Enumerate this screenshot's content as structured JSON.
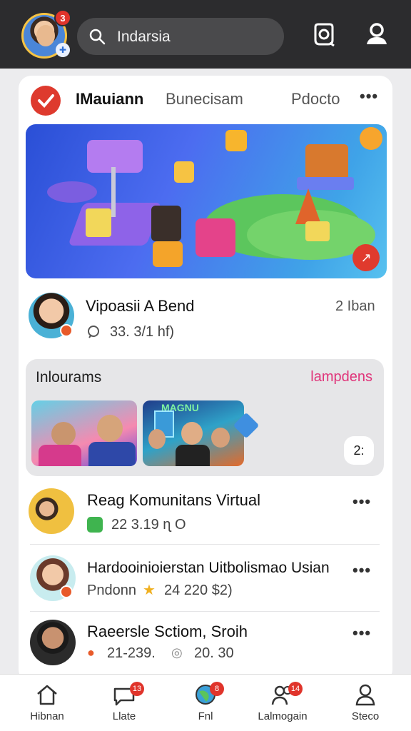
{
  "header": {
    "avatar_badge": "3",
    "search_value": "Indarsia"
  },
  "tabs": [
    {
      "label": "IMauiann"
    },
    {
      "label": "Bunecisam"
    },
    {
      "label": "Pdocto"
    }
  ],
  "feed": {
    "item1": {
      "name": "Vipoasii A Bend",
      "time": "2 Iban",
      "meta": "33. 3/1 hf)"
    },
    "carousel": {
      "title": "Inlourams",
      "link": "lampdens",
      "thumb2_caption": "MAGNU",
      "more_count": "2:"
    },
    "item2": {
      "name": "Reag Komunitans Virtual",
      "meta": "22  3.19 ɳ O"
    },
    "item3": {
      "name": "Hardooinioierstan Uitbolismao Usian",
      "meta_label": "Pndonn",
      "meta_value": "24 220 $2)"
    },
    "item4": {
      "name": "Raeersle Sctiom, Sroih",
      "meta_left": "21-239.",
      "meta_right": "20. 30"
    }
  },
  "bottom_nav": [
    {
      "label": "Hibnan",
      "icon": "home-icon",
      "badge": ""
    },
    {
      "label": "Llate",
      "icon": "chat-icon",
      "badge": "13"
    },
    {
      "label": "Fnl",
      "icon": "globe-icon",
      "badge": "8"
    },
    {
      "label": "Lalmogain",
      "icon": "people-icon",
      "badge": "14"
    },
    {
      "label": "Steco",
      "icon": "profile-icon",
      "badge": ""
    }
  ],
  "colors": {
    "accent": "#e0342b",
    "link": "#e0357a",
    "topbar": "#2c2c2e"
  }
}
